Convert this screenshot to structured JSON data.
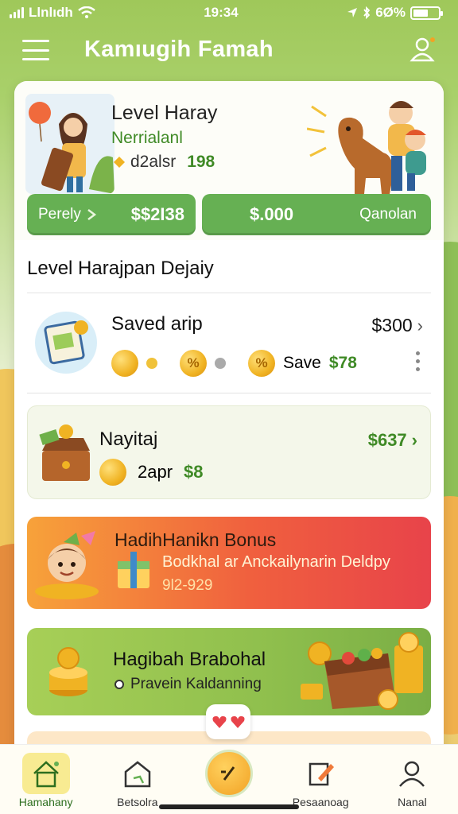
{
  "status_bar": {
    "carrier": "Llnlıdh",
    "time": "19:34",
    "battery": "6Ø%"
  },
  "app_bar": {
    "title": "Kamıugih Famah"
  },
  "hero": {
    "title": "Level Haray",
    "subtitle": "Nerrialanl",
    "stat_label": "d2alsr",
    "stat_value": "198",
    "button_left_label": "Perely",
    "button_left_amount": "$$2Ɩ38",
    "button_right_amount": "$.000",
    "button_right_label": "Qanolan"
  },
  "section": {
    "title": "Level Harajpan Dejaiy"
  },
  "saved_row": {
    "title": "Saved arip",
    "amount": "$300",
    "save_label": "Save",
    "save_value": "$78"
  },
  "pay_card": {
    "title": "Nayitaj",
    "amount": "$637",
    "line_label": "2apr",
    "line_value": "$8"
  },
  "bonus_card": {
    "title": "HadihHanikn Bonus",
    "desc": "Bodkhal ar Anckailynarin Deldpy",
    "range": "9Ɩ2-929"
  },
  "promo_card": {
    "title": "Hagibah Brabohal",
    "subtitle": "Pravein Kaldanning"
  },
  "nav": [
    {
      "label": "Hamahany"
    },
    {
      "label": "Betsolra"
    },
    {
      "label": ""
    },
    {
      "label": "Pesaanoag"
    },
    {
      "label": "Nanal"
    }
  ],
  "colors": {
    "brand_green": "#66b053",
    "accent_yellow": "#f2a224",
    "bonus_red": "#e8434a"
  }
}
